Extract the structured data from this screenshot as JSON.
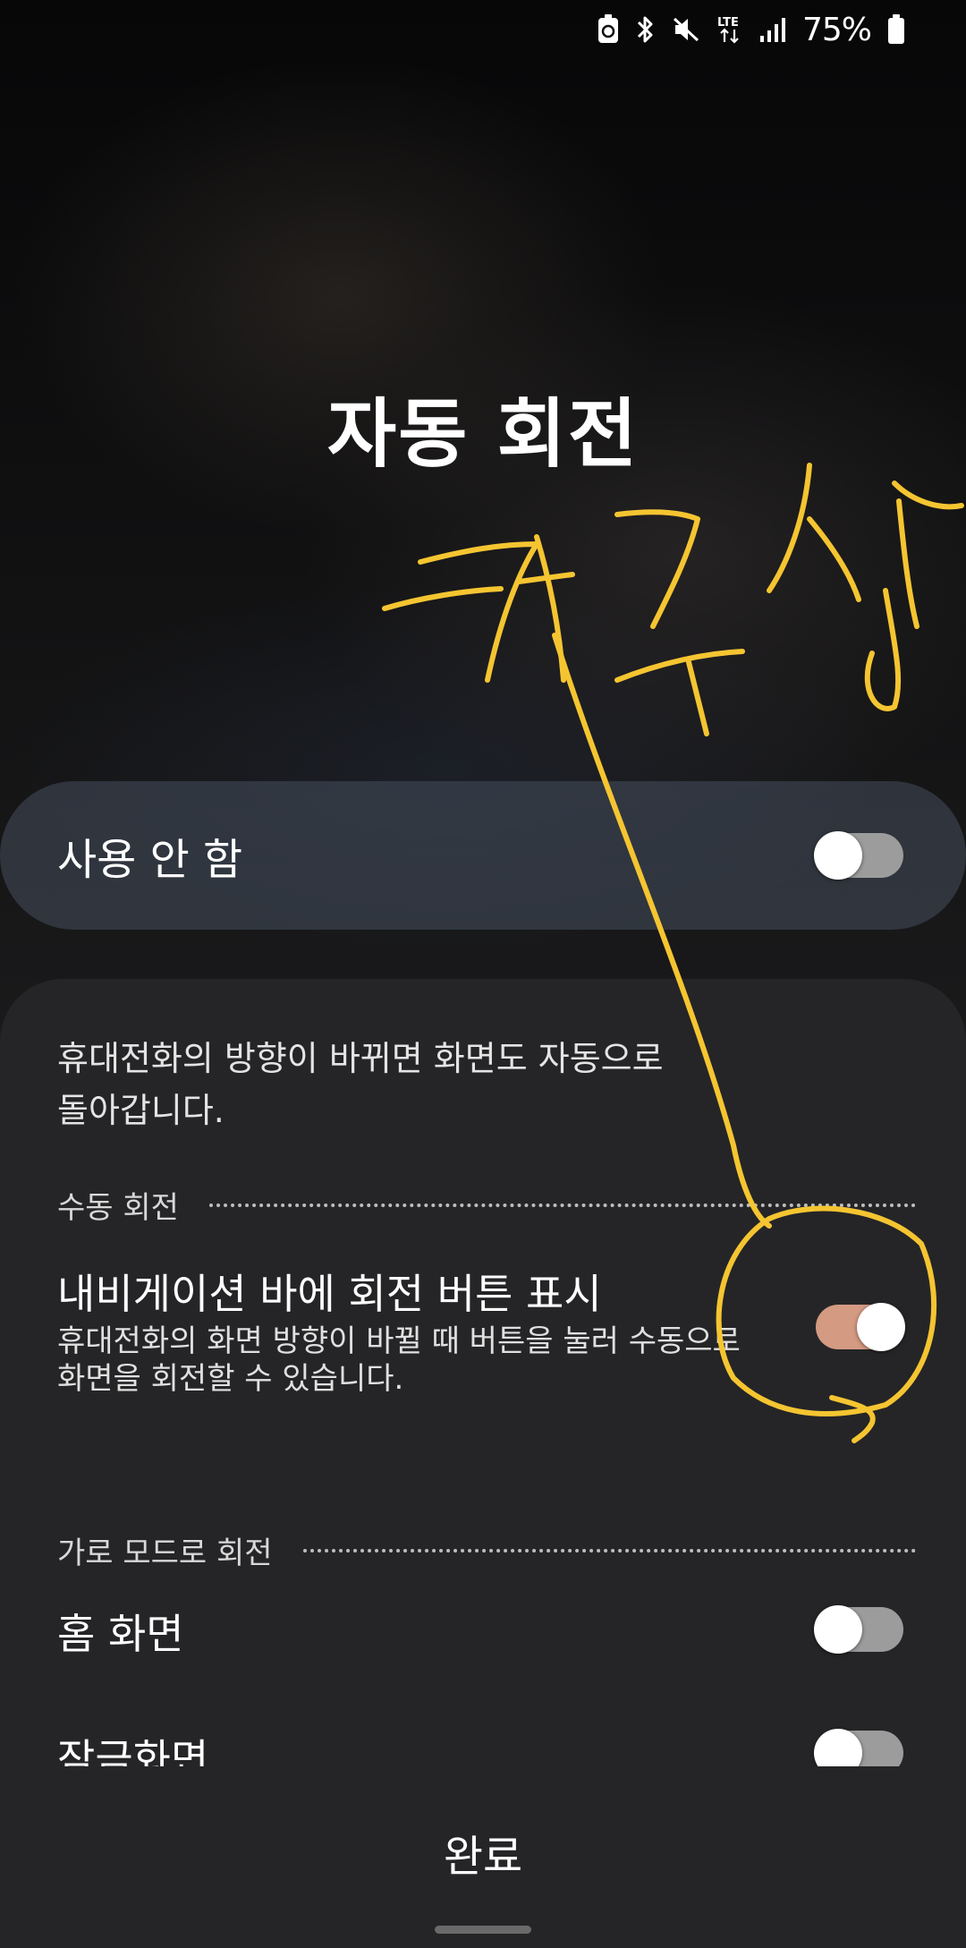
{
  "status_bar": {
    "battery_percent": "75%",
    "icons": [
      "battery-saver-icon",
      "bluetooth-icon",
      "mute-icon",
      "lte-icon",
      "signal-icon",
      "battery-icon"
    ],
    "lte_label": "LTE"
  },
  "page": {
    "title": "자동 회전"
  },
  "master_switch": {
    "label": "사용 안 함",
    "enabled": false
  },
  "panel": {
    "description_line1": "휴대전화의 방향이 바뀌면 화면도 자동으로",
    "description_line2": "돌아갑니다.",
    "manual_section": {
      "header": "수동 회전",
      "items": [
        {
          "title": "내비게이션 바에 회전 버튼 표시",
          "subtitle_line1": "휴대전화의 화면 방향이 바뀔 때 버튼을 눌러 수동으로",
          "subtitle_line2": "화면을 회전할 수 있습니다.",
          "enabled": true
        }
      ]
    },
    "landscape_section": {
      "header": "가로 모드로 회전",
      "items": [
        {
          "title": "홈 화면",
          "enabled": false
        },
        {
          "title": "잠금화면",
          "enabled": false
        }
      ]
    }
  },
  "footer": {
    "done_label": "완료"
  },
  "annotation": {
    "handwritten_text": "켜주삼",
    "color": "#f5c531"
  },
  "colors": {
    "toggle_on": "#d49a82",
    "toggle_off": "#9c9c9c",
    "panel_bg": "#252527"
  }
}
